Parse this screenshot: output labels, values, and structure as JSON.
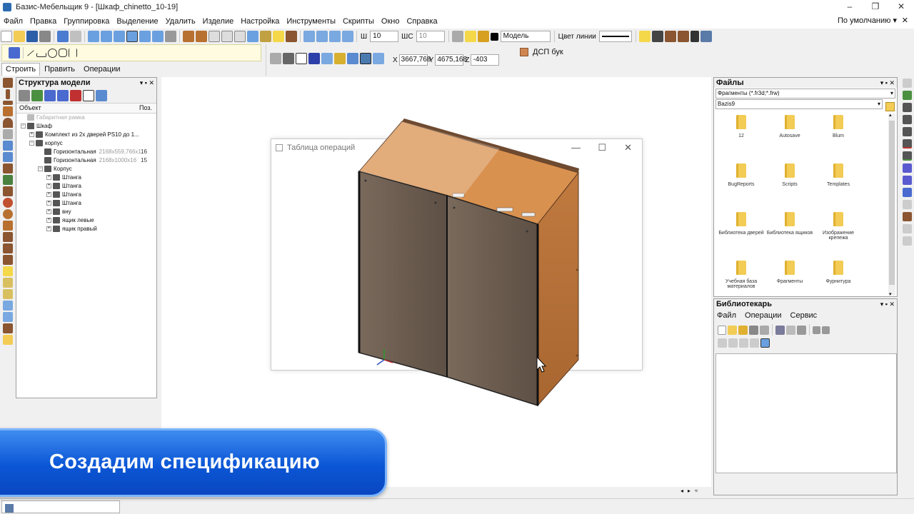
{
  "window": {
    "title": "Базис-Мебельщик 9 - [Шкаф_chinetto_10-19]",
    "minimize": "–",
    "maximize": "❐",
    "close": "✕"
  },
  "menu": [
    "Файл",
    "Правка",
    "Группировка",
    "Выделение",
    "Удалить",
    "Изделие",
    "Настройка",
    "Инструменты",
    "Скрипты",
    "Окно",
    "Справка"
  ],
  "preset": {
    "label": "По умолчанию",
    "arrow": "▾",
    "close": "✕"
  },
  "toolbar": {
    "w_label": "Ш",
    "w_value": "10",
    "ws_label": "ШС",
    "ws_value": "10",
    "layer_value": "Модель",
    "line_color_label": "Цвет линии"
  },
  "build_tabs": [
    "Строить",
    "Править",
    "Операции"
  ],
  "coords": {
    "x_label": "X",
    "x_value": "3667,768",
    "y_label": "Y",
    "y_value": "4675,168",
    "z_label": "Z",
    "z_value": "-403"
  },
  "material": {
    "name": "ДСП бук",
    "color": "#d08550"
  },
  "structure": {
    "title": "Структура модели",
    "controls": "▾ ▪ ✕",
    "col_object": "Объект",
    "col_pos": "Поз.",
    "rows": [
      {
        "indent": 0,
        "exp": "",
        "text": "Габаритная рамка",
        "muted": true,
        "dim": "",
        "pos": ""
      },
      {
        "indent": 0,
        "exp": "−",
        "text": "Шкаф",
        "muted": false,
        "dim": "",
        "pos": ""
      },
      {
        "indent": 1,
        "exp": "+",
        "text": "Комплект из 2х дверей PS10 до 1...",
        "muted": false,
        "dim": "",
        "pos": ""
      },
      {
        "indent": 1,
        "exp": "−",
        "text": "корпус",
        "muted": false,
        "dim": "",
        "pos": ""
      },
      {
        "indent": 2,
        "exp": "",
        "text": "Горизонтальная",
        "muted": false,
        "dim": "2168x559,766x1",
        "pos": "16"
      },
      {
        "indent": 2,
        "exp": "",
        "text": "Горизонтальная",
        "muted": false,
        "dim": "2168x1000x16",
        "pos": "15"
      },
      {
        "indent": 2,
        "exp": "−",
        "text": "Корпус",
        "muted": false,
        "dim": "",
        "pos": ""
      },
      {
        "indent": 3,
        "exp": "+",
        "text": "Штанга",
        "muted": false,
        "dim": "",
        "pos": ""
      },
      {
        "indent": 3,
        "exp": "+",
        "text": "Штанга",
        "muted": false,
        "dim": "",
        "pos": ""
      },
      {
        "indent": 3,
        "exp": "+",
        "text": "Штанга",
        "muted": false,
        "dim": "",
        "pos": ""
      },
      {
        "indent": 3,
        "exp": "+",
        "text": "Штанга",
        "muted": false,
        "dim": "",
        "pos": ""
      },
      {
        "indent": 3,
        "exp": "+",
        "text": "вну",
        "muted": false,
        "dim": "",
        "pos": ""
      },
      {
        "indent": 3,
        "exp": "+",
        "text": "ящик левые",
        "muted": false,
        "dim": "",
        "pos": ""
      },
      {
        "indent": 3,
        "exp": "+",
        "text": "ящик правый",
        "muted": false,
        "dim": "",
        "pos": ""
      }
    ]
  },
  "op_table": {
    "title": "Таблица операций",
    "min": "—",
    "max": "☐",
    "close": "✕"
  },
  "files": {
    "title": "Файлы",
    "controls": "▾ ▪ ✕",
    "filter": "Фрагменты (*.fr3d;*.frw)",
    "path": "Bazis9",
    "dropdown_arrow": "▾",
    "scroll_up": "▴",
    "scroll_down": "▾",
    "folders": [
      "12",
      "Autosave",
      "Blum",
      "BugReports",
      "Scripts",
      "Templates",
      "Библиотека дверей",
      "Библиотека ящиков",
      "Изображение крепежа",
      "Учебная база материалов",
      "Фрагменты",
      "Фурнитура"
    ]
  },
  "librarian": {
    "title": "Библиотекарь",
    "controls": "▾ ▪ ✕",
    "menu": [
      "Файл",
      "Операции",
      "Сервис"
    ]
  },
  "nav": [
    "◂",
    "▸",
    "≈"
  ],
  "caption": "Создадим спецификацию",
  "colors": {
    "wood_door": "#6e5f52",
    "wood_side": "#b8743c",
    "wood_top": "#d9914f",
    "banner": "#0b56d6"
  }
}
